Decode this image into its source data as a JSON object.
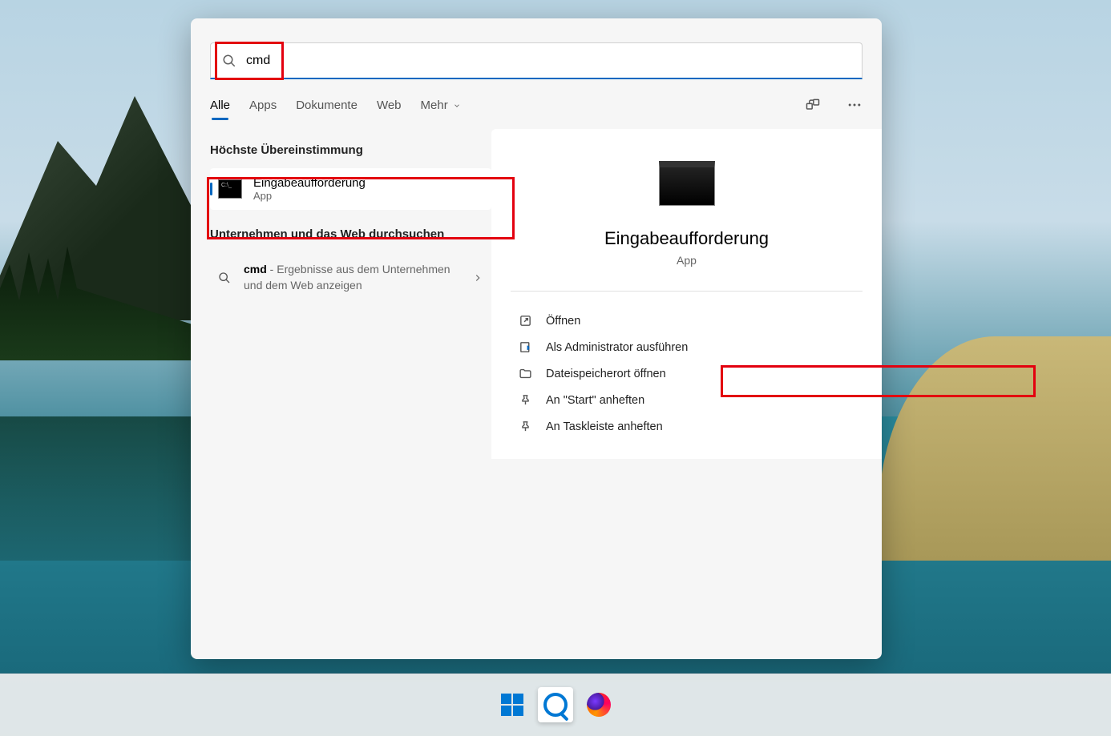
{
  "search": {
    "value": "cmd"
  },
  "tabs": {
    "all": "Alle",
    "apps": "Apps",
    "docs": "Dokumente",
    "web": "Web",
    "more": "Mehr"
  },
  "sections": {
    "best": "Höchste Übereinstimmung",
    "web": "Unternehmen und das Web durchsuchen"
  },
  "best_result": {
    "title": "Eingabeaufforderung",
    "type": "App"
  },
  "web_result": {
    "query": "cmd",
    "desc": " - Ergebnisse aus dem Unternehmen und dem Web anzeigen"
  },
  "detail": {
    "title": "Eingabeaufforderung",
    "type": "App",
    "actions": {
      "open": "Öffnen",
      "admin": "Als Administrator ausführen",
      "location": "Dateispeicherort öffnen",
      "pin_start": "An \"Start\" anheften",
      "pin_taskbar": "An Taskleiste anheften"
    }
  }
}
